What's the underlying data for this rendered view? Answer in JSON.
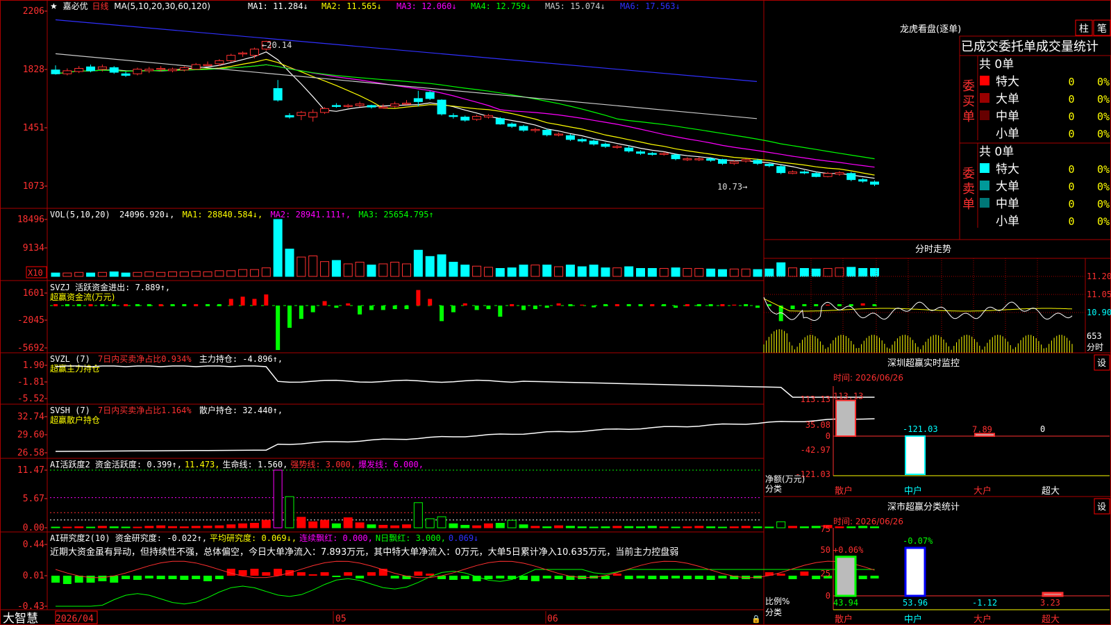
{
  "header": {
    "star": "★",
    "name": "嘉必优",
    "period": "日线",
    "ma_prefix": "MA(5,10,20,30,60,120)",
    "ma_values": [
      {
        "label": "MA1: 11.284↓",
        "color": "#ffffff"
      },
      {
        "label": "MA2: 11.565↓",
        "color": "#ffff00"
      },
      {
        "label": "MA3: 12.060↓",
        "color": "#ff00ff"
      },
      {
        "label": "MA4: 12.759↓",
        "color": "#00ff00"
      },
      {
        "label": "MA5: 15.074↓",
        "color": "#cccccc"
      },
      {
        "label": "MA6: 17.563↓",
        "color": "#3030ff"
      }
    ]
  },
  "price_axis": [
    "2206",
    "1828",
    "1451",
    "1073"
  ],
  "price_annotations": {
    "high": "20.14",
    "low": "10.73"
  },
  "vol_panel": {
    "axis": [
      "18496",
      "9134"
    ],
    "unit": "X10",
    "title": "VOL(5,10,20)",
    "value": "24096.920↓,",
    "ma": [
      {
        "label": "MA1: 28840.584↓,",
        "color": "#ffff00"
      },
      {
        "label": "MA2: 28941.111↑,",
        "color": "#ff00ff"
      },
      {
        "label": "MA3: 25654.795↑",
        "color": "#00ff00"
      }
    ]
  },
  "svzj_panel": {
    "axis": [
      "1601",
      "-2045",
      "-5692"
    ],
    "line1": "SVZJ  活跃资金进出: 7.889↑,",
    "line2": "超赢资金流(万元)"
  },
  "svzl_panel": {
    "axis": [
      "1.90",
      "-1.81",
      "-5.52"
    ],
    "name": "SVZL (7)",
    "ratio": "7日内买卖净占比0.934%",
    "hold": "主力持仓: -4.896↑,",
    "line2": "超赢主力持仓"
  },
  "svsh_panel": {
    "axis": [
      "32.74",
      "29.60",
      "26.58"
    ],
    "name": "SVSH (7)",
    "ratio": "7日内买卖净占比1.164%",
    "hold": "散户持仓: 32.440↑,",
    "line2": "超赢散户持仓"
  },
  "ai1_panel": {
    "axis": [
      "11.47",
      "5.67",
      "0.00"
    ],
    "parts": [
      {
        "t": "AI活跃度2 资金活跃度: 0.399↑,",
        "c": "#ffffff"
      },
      {
        "t": "11.473,",
        "c": "#ffff00"
      },
      {
        "t": "生命线: 1.560,",
        "c": "#ffffff"
      },
      {
        "t": "强势线: 3.000,",
        "c": "#ff3030"
      },
      {
        "t": "爆发线: 6.000,",
        "c": "#ff00ff"
      }
    ]
  },
  "ai2_panel": {
    "axis": [
      "0.44",
      "0.01",
      "-0.43"
    ],
    "parts": [
      {
        "t": "AI研究度2(10) 资金研究度: -0.022↑,",
        "c": "#ffffff"
      },
      {
        "t": "平均研究度: 0.069↓,",
        "c": "#ffff00"
      },
      {
        "t": "连续飘红: 0.000,",
        "c": "#ff00ff"
      },
      {
        "t": "N日飘红: 3.000,",
        "c": "#00ff00"
      },
      {
        "t": "0.069↓",
        "c": "#3030ff"
      }
    ],
    "note": "近期大资金虽有异动，但持续性不强，总体偏空，今日大单净流入：7.893万元，其中特大单净流入：0万元，大单5日累计净入10.635万元，当前主力控盘弱"
  },
  "bottom": {
    "brand": "大智慧",
    "dates": [
      "2026/04",
      "05",
      "06"
    ]
  },
  "dragon": {
    "title": "龙虎看盘(逐单)",
    "btn_col": "柱",
    "btn_pen": "笔",
    "tab_bar": "已成交委托单成交量统计",
    "buy": {
      "side": "委买单",
      "total": "共 0单",
      "rows": [
        {
          "name": "特大",
          "n": "0",
          "p": "0%",
          "color": "#ff0000"
        },
        {
          "name": "大单",
          "n": "0",
          "p": "0%",
          "color": "#990000"
        },
        {
          "name": "中单",
          "n": "0",
          "p": "0%",
          "color": "#660000"
        },
        {
          "name": "小单",
          "n": "0",
          "p": "0%",
          "color": ""
        }
      ]
    },
    "sell": {
      "side": "委卖单",
      "total": "共 0单",
      "rows": [
        {
          "name": "特大",
          "n": "0",
          "p": "0%",
          "color": "#00ffff"
        },
        {
          "name": "大单",
          "n": "0",
          "p": "0%",
          "color": "#009999"
        },
        {
          "name": "中单",
          "n": "0",
          "p": "0%",
          "color": "#007777"
        },
        {
          "name": "小单",
          "n": "0",
          "p": "0%",
          "color": ""
        }
      ]
    }
  },
  "intraday": {
    "title": "分时走势",
    "axis": [
      "11.20",
      "11.05",
      "10.90"
    ],
    "vol": "653",
    "vol_label": "分时"
  },
  "monitor": {
    "title": "深圳超赢实时监控",
    "set": "设",
    "time": "时间: 2026/06/26",
    "axis": [
      "113.13",
      "35.08",
      "0",
      "-42.97",
      "-121.03"
    ],
    "ylabel": "净额(万元)",
    "xlabel": "分类",
    "cats": [
      "散户",
      "中户",
      "大户",
      "超大"
    ],
    "values": [
      "113.13",
      "-121.03",
      "7.89",
      "0"
    ]
  },
  "classify": {
    "title": "深市超赢分类统计",
    "set": "设",
    "time": "时间: 2026/06/26",
    "axis": [
      "75",
      "50",
      "25",
      "0"
    ],
    "ylabel": "比例%",
    "xlabel": "分类",
    "cats": [
      "散户",
      "中户",
      "大户",
      "超大"
    ],
    "top": [
      "+0.06%",
      "-0.07%"
    ],
    "values": [
      "43.94",
      "53.96",
      "-1.12",
      "3.23"
    ]
  },
  "chart_data": {
    "type": "candlestick",
    "note_series": "daily candles, approx price (yuan)",
    "candles": [
      [
        18.25,
        18.0,
        18.55,
        17.95
      ],
      [
        18.0,
        18.2,
        18.35,
        17.9
      ],
      [
        18.15,
        18.35,
        18.5,
        18.05
      ],
      [
        18.45,
        18.2,
        18.6,
        18.1
      ],
      [
        18.3,
        18.45,
        18.6,
        18.15
      ],
      [
        18.4,
        18.1,
        18.5,
        18.0
      ],
      [
        18.0,
        17.9,
        18.15,
        17.8
      ],
      [
        18.0,
        18.3,
        18.4,
        17.9
      ],
      [
        18.2,
        18.3,
        18.45,
        18.05
      ],
      [
        18.3,
        18.35,
        18.5,
        18.15
      ],
      [
        18.2,
        18.3,
        18.4,
        18.1
      ],
      [
        18.25,
        18.4,
        18.5,
        18.15
      ],
      [
        18.3,
        18.6,
        18.7,
        18.25
      ],
      [
        18.6,
        18.6,
        18.8,
        18.5
      ],
      [
        18.65,
        18.85,
        18.95,
        18.5
      ],
      [
        18.85,
        19.2,
        19.3,
        18.75
      ],
      [
        19.3,
        19.35,
        19.45,
        19.1
      ],
      [
        19.2,
        19.6,
        19.7,
        19.0
      ],
      [
        19.6,
        20.1,
        20.14,
        19.5
      ],
      [
        17.05,
        16.3,
        17.6,
        16.2
      ],
      [
        15.3,
        15.2,
        15.45,
        15.1
      ],
      [
        15.3,
        15.5,
        15.6,
        15.0
      ],
      [
        15.2,
        15.5,
        15.7,
        14.9
      ],
      [
        15.5,
        15.75,
        15.85,
        15.4
      ],
      [
        15.95,
        15.9,
        16.1,
        15.8
      ],
      [
        15.9,
        15.95,
        16.05,
        15.8
      ],
      [
        15.95,
        16.05,
        16.2,
        15.85
      ],
      [
        15.95,
        15.85,
        16.0,
        15.75
      ],
      [
        15.85,
        15.85,
        16.05,
        15.75
      ],
      [
        15.9,
        16.05,
        16.2,
        15.8
      ],
      [
        16.1,
        16.1,
        16.3,
        16.0
      ],
      [
        16.4,
        16.2,
        16.9,
        15.9
      ],
      [
        16.8,
        16.4,
        16.9,
        16.3
      ],
      [
        16.3,
        15.4,
        16.35,
        15.3
      ],
      [
        15.3,
        15.25,
        15.45,
        15.1
      ],
      [
        15.2,
        15.0,
        15.3,
        14.9
      ],
      [
        15.05,
        15.25,
        15.35,
        14.95
      ],
      [
        15.2,
        15.3,
        15.4,
        15.1
      ],
      [
        15.1,
        14.75,
        15.2,
        14.7
      ],
      [
        14.75,
        14.6,
        14.85,
        14.5
      ],
      [
        14.6,
        14.35,
        14.7,
        14.25
      ],
      [
        14.35,
        14.4,
        14.5,
        14.2
      ],
      [
        14.35,
        14.05,
        14.45,
        13.95
      ],
      [
        14.1,
        14.1,
        14.2,
        13.95
      ],
      [
        14.0,
        13.75,
        14.1,
        13.65
      ],
      [
        13.75,
        13.65,
        13.85,
        13.55
      ],
      [
        13.65,
        13.45,
        13.75,
        13.35
      ],
      [
        13.45,
        13.3,
        13.55,
        13.2
      ],
      [
        13.3,
        13.3,
        13.4,
        13.15
      ],
      [
        13.2,
        13.0,
        13.35,
        12.9
      ],
      [
        12.95,
        12.85,
        13.05,
        12.75
      ],
      [
        12.85,
        12.8,
        12.95,
        12.7
      ],
      [
        12.8,
        12.85,
        12.95,
        12.7
      ],
      [
        12.75,
        12.5,
        12.85,
        12.4
      ],
      [
        12.45,
        12.5,
        12.6,
        12.35
      ],
      [
        12.45,
        12.5,
        12.6,
        12.35
      ],
      [
        12.5,
        12.4,
        12.6,
        12.3
      ],
      [
        12.45,
        12.2,
        12.5,
        12.1
      ],
      [
        12.2,
        12.3,
        12.4,
        12.1
      ],
      [
        12.35,
        12.45,
        12.5,
        12.25
      ],
      [
        12.4,
        12.2,
        12.5,
        12.1
      ],
      [
        12.15,
        12.05,
        12.25,
        11.95
      ],
      [
        12.0,
        11.6,
        12.1,
        11.5
      ],
      [
        11.55,
        11.65,
        11.75,
        11.5
      ],
      [
        11.65,
        11.6,
        11.75,
        11.5
      ],
      [
        11.55,
        11.35,
        11.65,
        11.3
      ],
      [
        11.35,
        11.55,
        11.65,
        11.3
      ],
      [
        11.5,
        11.6,
        11.7,
        11.4
      ],
      [
        11.55,
        11.15,
        11.65,
        11.05
      ],
      [
        11.15,
        11.05,
        11.25,
        10.95
      ],
      [
        11.0,
        10.85,
        11.1,
        10.73
      ]
    ],
    "vol_rel": [
      0.06,
      0.06,
      0.07,
      0.06,
      0.07,
      0.08,
      0.06,
      0.07,
      0.08,
      0.07,
      0.08,
      0.08,
      0.09,
      0.08,
      0.1,
      0.1,
      0.12,
      0.12,
      0.15,
      1.0,
      0.48,
      0.34,
      0.36,
      0.26,
      0.28,
      0.22,
      0.25,
      0.2,
      0.22,
      0.25,
      0.22,
      0.46,
      0.35,
      0.38,
      0.25,
      0.2,
      0.18,
      0.16,
      0.14,
      0.15,
      0.2,
      0.2,
      0.2,
      0.17,
      0.2,
      0.17,
      0.2,
      0.15,
      0.15,
      0.17,
      0.14,
      0.14,
      0.14,
      0.15,
      0.14,
      0.14,
      0.13,
      0.12,
      0.13,
      0.13,
      0.12,
      0.13,
      0.24,
      0.15,
      0.14,
      0.13,
      0.14,
      0.15,
      0.16,
      0.14,
      0.14
    ],
    "zj": [
      0,
      0,
      0,
      0,
      0,
      0,
      0,
      0,
      0,
      0,
      0,
      0,
      0,
      0,
      0,
      0.15,
      0.2,
      0.15,
      0.25,
      -1.0,
      -0.5,
      -0.3,
      -0.15,
      0.1,
      -0.05,
      0.05,
      -0.2,
      -0.1,
      -0.1,
      -0.08,
      -0.08,
      0.35,
      0.15,
      -0.35,
      -0.15,
      0.05,
      -0.1,
      -0.08,
      -0.25,
      0,
      -0.1,
      -0.08,
      -0.05,
      0.05,
      0,
      0.02,
      -0.04,
      0,
      0,
      0,
      0,
      0,
      0,
      -0.05,
      0,
      0,
      0,
      0,
      0.02,
      0,
      -0.05,
      0,
      -0.35,
      -0.08,
      0,
      0,
      0.02,
      0,
      0,
      0.05,
      0
    ],
    "ai1": [
      0.1,
      0.05,
      0.2,
      0.1,
      0.3,
      0.2,
      0.15,
      0.1,
      0.3,
      0.4,
      0.25,
      0.2,
      0.3,
      0.35,
      0.4,
      0.6,
      0.8,
      0.9,
      1.5,
      11.47,
      6.2,
      2.1,
      1.2,
      1.5,
      0.8,
      2.0,
      1.0,
      0.6,
      0.5,
      0.4,
      0.6,
      5.0,
      1.8,
      2.2,
      0.8,
      0.5,
      0.4,
      0.8,
      0.9,
      1.5,
      0.6,
      0.3,
      0.2,
      0.4,
      0.3,
      0.2,
      0.15,
      0.2,
      0.3,
      0.25,
      0.2,
      0.3,
      0.2,
      0.15,
      0.2,
      0.3,
      0.2,
      0.1,
      0.2,
      0.3,
      0.2,
      0.15,
      1.2,
      0.3,
      0.2,
      0.3,
      0.5,
      0.2,
      0.2,
      0.3,
      0.2
    ],
    "ai2": [
      -0.1,
      -0.12,
      -0.1,
      -0.1,
      -0.08,
      -0.1,
      -0.05,
      -0.06,
      -0.04,
      -0.05,
      -0.05,
      -0.06,
      -0.05,
      -0.08,
      -0.05,
      0.1,
      0.08,
      0.1,
      0.05,
      0.1,
      0.08,
      0.05,
      0.02,
      0.05,
      -0.02,
      0.05,
      -0.04,
      0.05,
      0.1,
      -0.04,
      -0.05,
      0.06,
      0.03,
      -0.05,
      -0.06,
      -0.05,
      -0.08,
      -0.05,
      -0.04,
      -0.05,
      -0.06,
      -0.08,
      -0.04,
      -0.05,
      -0.06,
      -0.05,
      -0.04,
      -0.05,
      0.03,
      -0.05,
      -0.04,
      -0.05,
      -0.05,
      -0.04,
      -0.05,
      -0.05,
      -0.06,
      -0.04,
      -0.05,
      -0.05,
      -0.04,
      0.05,
      0.03,
      -0.05,
      0.06,
      -0.05,
      -0.04,
      -0.06,
      -0.05,
      -0.05,
      -0.04
    ]
  }
}
